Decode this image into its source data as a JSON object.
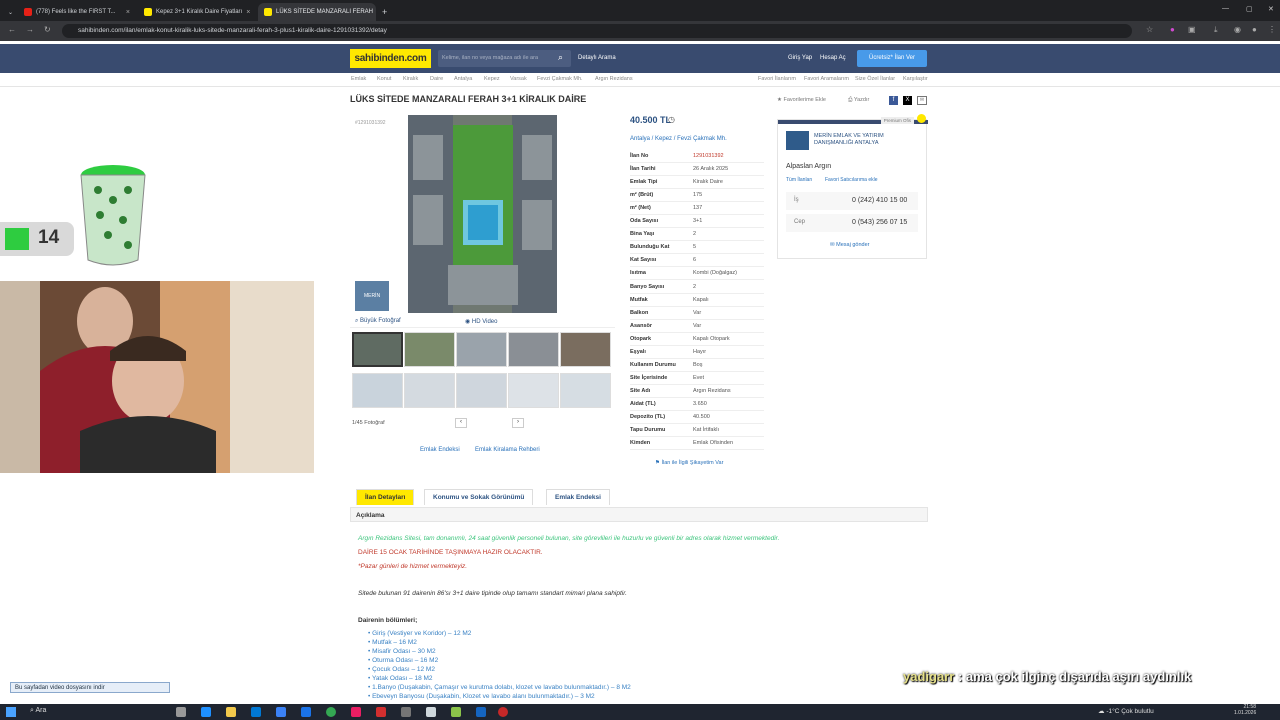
{
  "browser": {
    "tabs": [
      {
        "title": "(778) Feels like the FIRST T...",
        "color": "#e62117",
        "active": false
      },
      {
        "title": "Kepez 3+1 Kiralık Daire Fiyatları",
        "color": "#ffe800",
        "active": false
      },
      {
        "title": "LÜKS SİTEDE MANZARALI FERAH",
        "color": "#ffe800",
        "active": true
      }
    ],
    "new_tab": "+",
    "url": "sahibinden.com/ilan/emlak-konut-kiralik-luks-sitede-manzarali-ferah-3-plus1-kiralik-daire-1291031392/detay"
  },
  "site": {
    "logo": "sahibinden.com",
    "search_placeholder": "Kelime, ilan no veya mağaza adı ile ara",
    "detailed_search": "Detaylı Arama",
    "login": "Giriş Yap",
    "register": "Hesap Aç",
    "post_ad": "Ücretsiz* İlan Ver",
    "breadcrumbs": [
      "Emlak",
      "Konut",
      "Kiralık",
      "Daire",
      "Antalya",
      "Kepez",
      "Varsak",
      "Fevzi Çakmak Mh.",
      "Argın Rezidans"
    ],
    "top_links": [
      "Favori İlanlarım",
      "Favori Aramalarım",
      "Size Özel İlanlar",
      "Karşılaştır"
    ]
  },
  "listing": {
    "title": "LÜKS SİTEDE MANZARALI FERAH 3+1 KİRALIK DAİRE",
    "listing_no_small": "#1291031392",
    "add_fav": "Favorilerime Ekle",
    "print": "Yazdır",
    "price": "40.500 TL",
    "location": [
      "Antalya",
      "Kepez",
      "Fevzi Çakmak Mh."
    ],
    "photo_tabs": [
      "Büyük Fotoğraf",
      "HD Video"
    ],
    "photo_count": "1/45 Fotoğraf",
    "links": [
      "Emlak Endeksi",
      "Emlak Kiralama Rehberi"
    ],
    "report": "İlan ile İlgili Şikayetim Var",
    "details": [
      {
        "k": "İlan No",
        "v": "1291031392"
      },
      {
        "k": "İlan Tarihi",
        "v": "26 Aralık 2025"
      },
      {
        "k": "Emlak Tipi",
        "v": "Kiralık Daire"
      },
      {
        "k": "m² (Brüt)",
        "v": "175"
      },
      {
        "k": "m² (Net)",
        "v": "137"
      },
      {
        "k": "Oda Sayısı",
        "v": "3+1"
      },
      {
        "k": "Bina Yaşı",
        "v": "2"
      },
      {
        "k": "Bulunduğu Kat",
        "v": "5"
      },
      {
        "k": "Kat Sayısı",
        "v": "6"
      },
      {
        "k": "Isıtma",
        "v": "Kombi (Doğalgaz)"
      },
      {
        "k": "Banyo Sayısı",
        "v": "2"
      },
      {
        "k": "Mutfak",
        "v": "Kapalı"
      },
      {
        "k": "Balkon",
        "v": "Var"
      },
      {
        "k": "Asansör",
        "v": "Var"
      },
      {
        "k": "Otopark",
        "v": "Kapalı Otopark"
      },
      {
        "k": "Eşyalı",
        "v": "Hayır"
      },
      {
        "k": "Kullanım Durumu",
        "v": "Boş"
      },
      {
        "k": "Site İçerisinde",
        "v": "Evet"
      },
      {
        "k": "Site Adı",
        "v": "Argın Rezidans"
      },
      {
        "k": "Aidat (TL)",
        "v": "3.650"
      },
      {
        "k": "Depozito (TL)",
        "v": "40.500"
      },
      {
        "k": "Tapu Durumu",
        "v": "Kat İrtifaklı"
      },
      {
        "k": "Kimden",
        "v": "Emlak Ofisinden"
      }
    ]
  },
  "seller": {
    "premium": "Premium Ofis",
    "office": "MERİN EMLAK VE YATIRIM DANIŞMANLIĞI ANTALYA",
    "agent": "Alpaslan Argın",
    "all_ads": "Tüm İlanları",
    "fav_seller": "Favori Satıcılarıma ekle",
    "phones": [
      {
        "label": "İş",
        "number": "0 (242) 410 15 00"
      },
      {
        "label": "Cep",
        "number": "0 (543) 256 07 15"
      }
    ],
    "message": "Mesaj gönder"
  },
  "tabs": [
    "İlan Detayları",
    "Konumu ve Sokak Görünümü",
    "Emlak Endeksi"
  ],
  "description": {
    "heading": "Açıklama",
    "line1": "Argın Rezidans Sitesi, tam donanımlı, 24 saat güvenlik personeli bulunan, site görevlileri ile huzurlu ve güvenli bir adres olarak hizmet vermektedir.",
    "line2": "DAİRE 15 OCAK TARİHİNDE TAŞINMAYA HAZIR OLACAKTIR.",
    "line3": "*Pazar günleri de hizmet vermekteyiz.",
    "line4": "Sitede bulunan 91 dairenin 86'sı 3+1 daire tipinde olup tamamı standart mimari plana sahiptir.",
    "rooms_heading": "Dairenin bölümleri;",
    "rooms": [
      "Giriş (Vestiyer ve Koridor) – 12 M2",
      "Mutfak – 16 M2",
      "Misafir Odası – 30 M2",
      "Oturma Odası – 16 M2",
      "Çocuk Odası – 12 M2",
      "Yatak Odası – 18 M2",
      "1.Banyo (Duşakabin, Çamaşır ve kurutma dolabı, klozet ve lavabo bulunmaktadır.) – 8 M2",
      "Ebeveyn Banyosu (Duşakabin, Klozet ve lavabo alanı bulunmaktadır.) – 3 M2"
    ]
  },
  "overlay": {
    "counter": "14",
    "chat_user": "yadigarr",
    "chat_msg": ": ama çok ilginç dışarıda aşırı aydınlık",
    "download_bar": "Bu sayfadan video dosyasını indir"
  },
  "taskbar": {
    "search": "Ara",
    "weather": "-1°C  Çok bulutlu",
    "time": "21:58",
    "date": "1.01.2026"
  },
  "colors": {
    "brand": "#ffe800",
    "header": "#394b6f",
    "link": "#2870b9",
    "red": "#c0392b",
    "green": "#3cc47c"
  }
}
